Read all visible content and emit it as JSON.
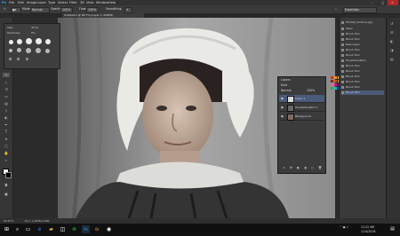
{
  "menu": {
    "logo": "Ps",
    "items": [
      "File",
      "Edit",
      "Image",
      "Layer",
      "Type",
      "Select",
      "Filter",
      "3D",
      "View",
      "Window",
      "Help"
    ]
  },
  "options": {
    "mode_label": "Mode:",
    "mode_value": "Normal",
    "opacity_label": "Opacity:",
    "opacity_value": "100%",
    "flow_label": "Flow:",
    "flow_value": "100%",
    "smoothing_label": "Smoothing:",
    "extra": "Essentials"
  },
  "document": {
    "tab_title": "Untitled-1 @ 66.7% (Layer 1, RGB/8)"
  },
  "brush_panel": {
    "size_label": "Size:",
    "size_value": "30 px",
    "hardness_label": "Hardness:",
    "hardness_value": "0%"
  },
  "layers_panel": {
    "title": "Layers",
    "kind": "Kind",
    "blend": "Normal",
    "opacity": "100%",
    "rows": [
      {
        "name": "Layer 1"
      },
      {
        "name": "Hue/Saturation 1"
      },
      {
        "name": "Background"
      }
    ]
  },
  "history": {
    "items": [
      "Portrait_Victoria.jpg",
      "Open",
      "Brush Tool",
      "Brush Tool",
      "New Layer",
      "Brush Tool",
      "Brush Tool",
      "Hue/Saturation",
      "Brush Tool",
      "Brush Tool",
      "Brush Tool",
      "Brush Tool",
      "Brush Tool",
      "Brush Tool"
    ]
  },
  "status": {
    "zoom": "66.67%",
    "doc": "Doc: 2.25M/4.50M"
  },
  "taskbar": {
    "time": "11:22 AM",
    "date": "1/14/2016"
  },
  "colors": {
    "accent": "#3d7bd8",
    "panel": "#3b3b3b"
  }
}
